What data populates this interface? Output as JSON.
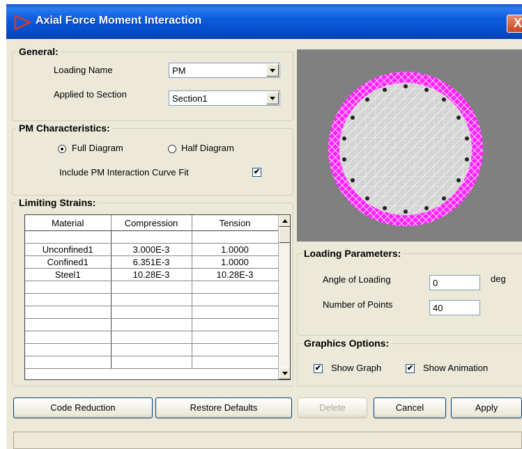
{
  "window": {
    "title": "Axial Force Moment Interaction",
    "close_label": "X"
  },
  "general": {
    "legend": "General:",
    "loading_name_label": "Loading Name",
    "loading_name_value": "PM",
    "applied_label": "Applied to Section",
    "applied_value": "Section1"
  },
  "pm": {
    "legend": "PM Characteristics:",
    "full_label": "Full Diagram",
    "half_label": "Half Diagram",
    "selected": "Full Diagram",
    "curve_fit_label": "Include PM Interaction Curve Fit",
    "curve_fit_checked": "✔"
  },
  "strains": {
    "legend": "Limiting Strains:",
    "columns": [
      "Material",
      "Compression",
      "Tension"
    ],
    "rows": [
      [
        "",
        "",
        ""
      ],
      [
        "Unconfined1",
        "3.000E-3",
        "1.0000"
      ],
      [
        "Confined1",
        "6.351E-3",
        "1.0000"
      ],
      [
        "Steel1",
        "10.28E-3",
        "10.28E-3"
      ],
      [
        "",
        "",
        ""
      ],
      [
        "",
        "",
        ""
      ],
      [
        "",
        "",
        ""
      ],
      [
        "",
        "",
        ""
      ],
      [
        "",
        "",
        ""
      ],
      [
        "",
        "",
        ""
      ],
      [
        "",
        "",
        ""
      ]
    ]
  },
  "preview": {
    "colors": {
      "background": "#808080",
      "cover": "#ff22ff",
      "core": "#d4d4d4",
      "rebar": "#222222"
    }
  },
  "loading_params": {
    "legend": "Loading Parameters:",
    "angle_label": "Angle of Loading",
    "angle_value": "0",
    "angle_unit": "deg",
    "points_label": "Number of Points",
    "points_value": "40"
  },
  "graphics": {
    "legend": "Graphics Options:",
    "show_graph_label": "Show Graph",
    "show_graph_checked": "✔",
    "show_anim_label": "Show Animation",
    "show_anim_checked": "✔"
  },
  "buttons": {
    "code_reduction": "Code Reduction",
    "restore_defaults": "Restore Defaults",
    "delete": "Delete",
    "cancel": "Cancel",
    "apply": "Apply"
  },
  "status": {
    "text": ""
  }
}
